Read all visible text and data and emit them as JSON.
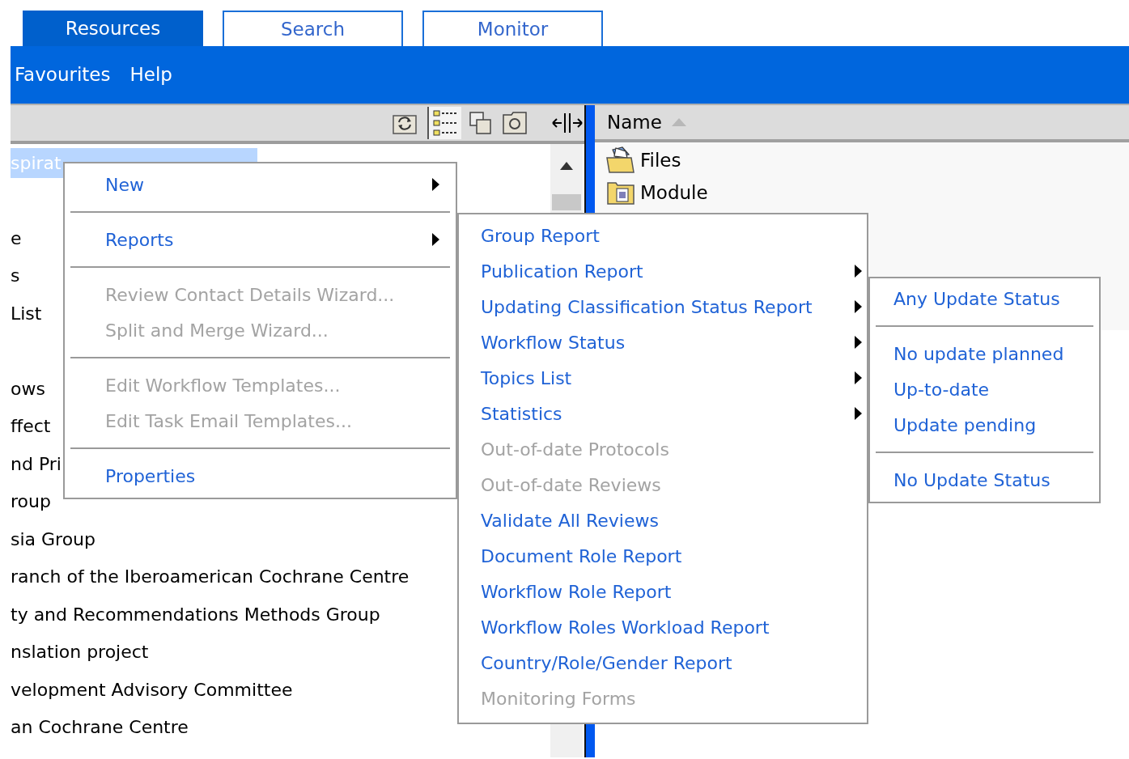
{
  "tabs": [
    {
      "label": "Resources",
      "selected": true
    },
    {
      "label": "Search",
      "selected": false
    },
    {
      "label": "Monitor",
      "selected": false
    }
  ],
  "menu_bar": [
    "Favourites",
    "Help"
  ],
  "tree": {
    "items": [
      {
        "label": "spirat",
        "selected": true
      },
      {
        "label": "e",
        "selected": false,
        "gap_before": true
      },
      {
        "label": "s",
        "selected": false
      },
      {
        "label": "List",
        "selected": false
      },
      {
        "label": "ows",
        "selected": false,
        "gap_before": true
      },
      {
        "label": "ffect",
        "selected": false
      },
      {
        "label": "nd Pri",
        "selected": false
      },
      {
        "label": "roup",
        "selected": false
      },
      {
        "label": "sia Group",
        "selected": false
      },
      {
        "label": "ranch of the Iberoamerican Cochrane Centre",
        "selected": false
      },
      {
        "label": "ty and Recommendations Methods Group",
        "selected": false
      },
      {
        "label": "nslation project",
        "selected": false
      },
      {
        "label": "velopment Advisory Committee",
        "selected": false
      },
      {
        "label": "an Cochrane Centre",
        "selected": false
      }
    ]
  },
  "file_list": {
    "column": "Name",
    "sort_ascending": true,
    "items": [
      {
        "name": "Files",
        "kind": "files"
      },
      {
        "name": "Module",
        "kind": "module"
      }
    ]
  },
  "context_menu": {
    "items": [
      {
        "kind": "item",
        "label": "New",
        "disabled": false,
        "submenu": true
      },
      {
        "kind": "separator"
      },
      {
        "kind": "item",
        "label": "Reports",
        "disabled": false,
        "submenu": true
      },
      {
        "kind": "separator"
      },
      {
        "kind": "item",
        "label": "Review Contact Details Wizard...",
        "disabled": true,
        "submenu": false
      },
      {
        "kind": "item",
        "label": "Split and Merge Wizard...",
        "disabled": true,
        "submenu": false
      },
      {
        "kind": "separator"
      },
      {
        "kind": "item",
        "label": "Edit Workflow Templates...",
        "disabled": true,
        "submenu": false
      },
      {
        "kind": "item",
        "label": "Edit Task Email Templates...",
        "disabled": true,
        "submenu": false
      },
      {
        "kind": "separator"
      },
      {
        "kind": "item",
        "label": "Properties",
        "disabled": false,
        "submenu": false
      }
    ]
  },
  "reports_menu": {
    "items": [
      {
        "kind": "item",
        "label": "Group Report",
        "disabled": false,
        "submenu": false
      },
      {
        "kind": "item",
        "label": "Publication Report",
        "disabled": false,
        "submenu": true
      },
      {
        "kind": "item",
        "label": "Updating Classification Status Report",
        "disabled": false,
        "submenu": true
      },
      {
        "kind": "item",
        "label": "Workflow Status",
        "disabled": false,
        "submenu": true
      },
      {
        "kind": "item",
        "label": "Topics List",
        "disabled": false,
        "submenu": true
      },
      {
        "kind": "item",
        "label": "Statistics",
        "disabled": false,
        "submenu": true
      },
      {
        "kind": "item",
        "label": "Out-of-date Protocols",
        "disabled": true,
        "submenu": false
      },
      {
        "kind": "item",
        "label": "Out-of-date Reviews",
        "disabled": true,
        "submenu": false
      },
      {
        "kind": "item",
        "label": "Validate All Reviews",
        "disabled": false,
        "submenu": false
      },
      {
        "kind": "item",
        "label": "Document Role Report",
        "disabled": false,
        "submenu": false
      },
      {
        "kind": "item",
        "label": "Workflow Role Report",
        "disabled": false,
        "submenu": false
      },
      {
        "kind": "item",
        "label": "Workflow Roles Workload Report",
        "disabled": false,
        "submenu": false
      },
      {
        "kind": "item",
        "label": "Country/Role/Gender Report",
        "disabled": false,
        "submenu": false
      },
      {
        "kind": "item",
        "label": "Monitoring Forms",
        "disabled": true,
        "submenu": false
      }
    ]
  },
  "update_status_menu": {
    "items": [
      {
        "kind": "item",
        "label": "Any Update Status",
        "disabled": false,
        "submenu": false
      },
      {
        "kind": "separator"
      },
      {
        "kind": "item",
        "label": "No update planned",
        "disabled": false,
        "submenu": false
      },
      {
        "kind": "item",
        "label": "Up-to-date",
        "disabled": false,
        "submenu": false
      },
      {
        "kind": "item",
        "label": "Update pending",
        "disabled": false,
        "submenu": false
      },
      {
        "kind": "separator"
      },
      {
        "kind": "item",
        "label": "No Update Status",
        "disabled": false,
        "submenu": false
      }
    ]
  }
}
